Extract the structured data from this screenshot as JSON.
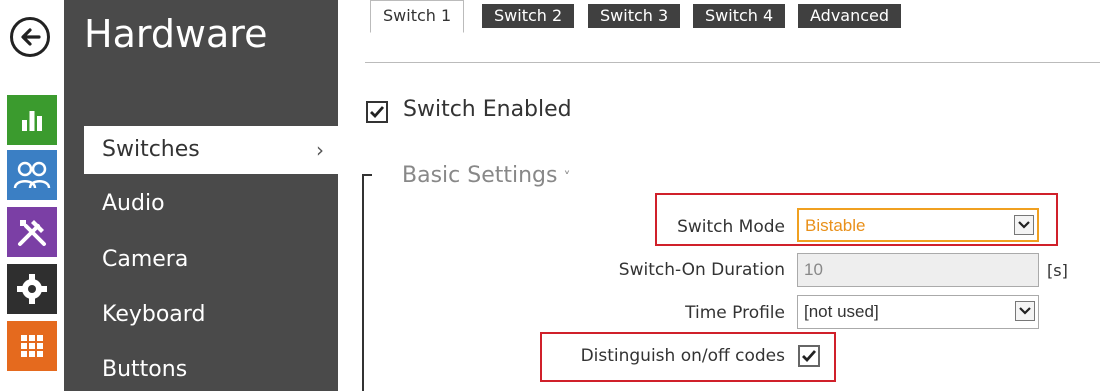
{
  "nav": {
    "title": "Hardware",
    "items": [
      {
        "label": "Switches",
        "active": true
      },
      {
        "label": "Audio"
      },
      {
        "label": "Camera"
      },
      {
        "label": "Keyboard"
      },
      {
        "label": "Buttons"
      }
    ],
    "chevron": "›"
  },
  "rail": {
    "icons": [
      "back-arrow-icon",
      "status-chart-icon",
      "users-icon",
      "hardware-tools-icon",
      "settings-gear-icon",
      "services-grid-icon"
    ],
    "colors": [
      "#3b9b2e",
      "#3b7fc4",
      "#7b3fa5",
      "#2f2f2f",
      "#e56a1e"
    ]
  },
  "tabs": [
    "Switch 1",
    "Switch 2",
    "Switch 3",
    "Switch 4",
    "Advanced"
  ],
  "switch_enabled": {
    "label": "Switch Enabled",
    "checked": true
  },
  "section": {
    "title": "Basic Settings",
    "chevron": "˅"
  },
  "fields": {
    "switch_mode": {
      "label": "Switch Mode",
      "value": "Bistable"
    },
    "switch_on_duration": {
      "label": "Switch-On Duration",
      "value": "10",
      "unit": "[s]"
    },
    "time_profile": {
      "label": "Time Profile",
      "value": "[not used]"
    },
    "distinguish_codes": {
      "label": "Distinguish on/off codes",
      "checked": true
    }
  },
  "colors": {
    "highlight": "#d0202a",
    "accent_orange": "#f0a020",
    "nav_bg": "#4a4a4a",
    "tab_bg": "#404040"
  }
}
